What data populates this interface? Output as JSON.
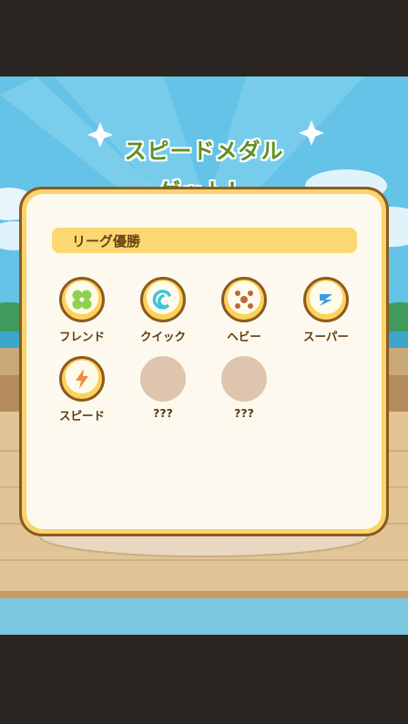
{
  "banner": {
    "line1": "スピードメダル",
    "line2": "ゲット！"
  },
  "panel": {
    "section_title": "リーグ優勝",
    "medals": [
      {
        "label": "フレンド",
        "icon": "clover-icon",
        "unlocked": true
      },
      {
        "label": "クイック",
        "icon": "swirl-icon",
        "unlocked": true
      },
      {
        "label": "ヘビー",
        "icon": "weight-icon",
        "unlocked": true
      },
      {
        "label": "スーパー",
        "icon": "super-z-icon",
        "unlocked": true
      },
      {
        "label": "スピード",
        "icon": "lightning-icon",
        "unlocked": true
      },
      {
        "label": "???",
        "icon": "",
        "unlocked": false
      },
      {
        "label": "???",
        "icon": "",
        "unlocked": false
      }
    ]
  },
  "colors": {
    "title_green": "#5e8f24",
    "panel_border": "#8a5a22",
    "panel_fill": "#fdf9ee",
    "header_yellow": "#fcd873",
    "locked_slot": "#ddc5ae"
  }
}
